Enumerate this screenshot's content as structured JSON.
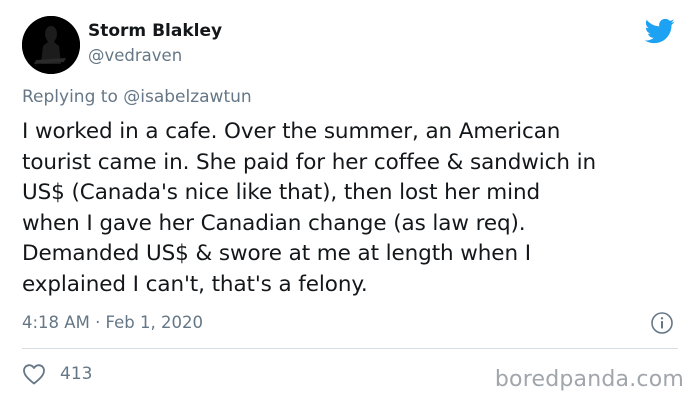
{
  "tweet": {
    "author": {
      "name": "Storm Blakley",
      "handle": "@vedraven"
    },
    "reply_prefix": "Replying to",
    "reply_to": "@isabelzawtun",
    "body_lines": [
      "I worked in a cafe. Over the summer, an American",
      "tourist came in. She paid for her coffee & sandwich in",
      "US$ (Canada's nice like that), then lost her mind",
      "when I gave her Canadian change (as law req).",
      "Demanded US$ & swore at me at length when I",
      "explained I can't, that's a felony."
    ],
    "timestamp": "4:18 AM · Feb 1, 2020",
    "likes": "413"
  },
  "watermark": "boredpanda.com",
  "icons": {
    "logo": "twitter-bird-icon",
    "info": "info-icon",
    "like": "heart-icon"
  },
  "colors": {
    "brand": "#1da1f2",
    "muted": "#657786",
    "text": "#14171a",
    "divider": "#d9dee2"
  }
}
